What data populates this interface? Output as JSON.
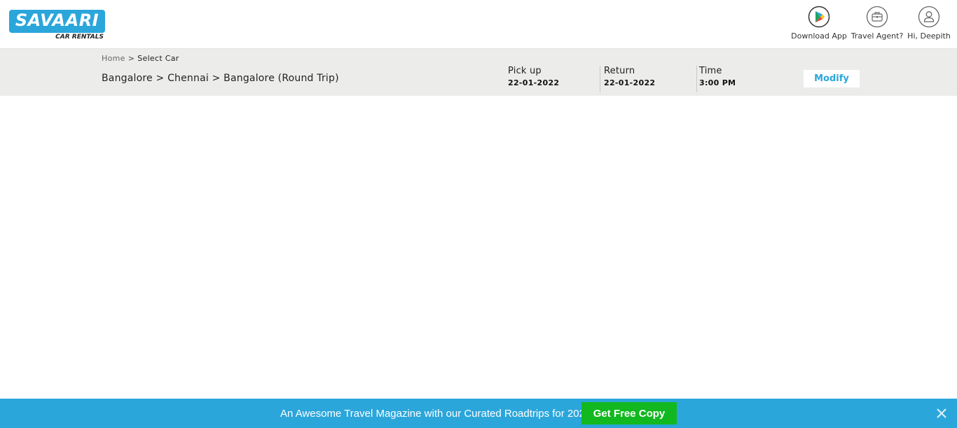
{
  "header": {
    "logo_text": "SAVAARI",
    "logo_subtext": "CAR RENTALS",
    "download_app_label": "Download App",
    "travel_agent_label": "Travel Agent?",
    "user_label": "Hi, Deepith"
  },
  "breadcrumb": {
    "home": "Home",
    "separator": ">",
    "current": "Select Car"
  },
  "trip": {
    "route": "Bangalore > Chennai > Bangalore (Round Trip)",
    "pickup_label": "Pick up",
    "pickup_date": "22-01-2022",
    "return_label": "Return",
    "return_date": "22-01-2022",
    "time_label": "Time",
    "time_value": "3:00 PM",
    "modify_label": "Modify"
  },
  "banner": {
    "text": "An Awesome Travel Magazine with our Curated Roadtrips for 2022",
    "button_label": "Get Free Copy"
  },
  "colors": {
    "brand_blue": "#2ba6db",
    "cta_green": "#12b81f",
    "subbar_bg": "#ececea"
  },
  "icons": {
    "download_app": "play-store-icon",
    "travel_agent": "briefcase-icon",
    "user": "user-icon",
    "close": "close-icon"
  }
}
